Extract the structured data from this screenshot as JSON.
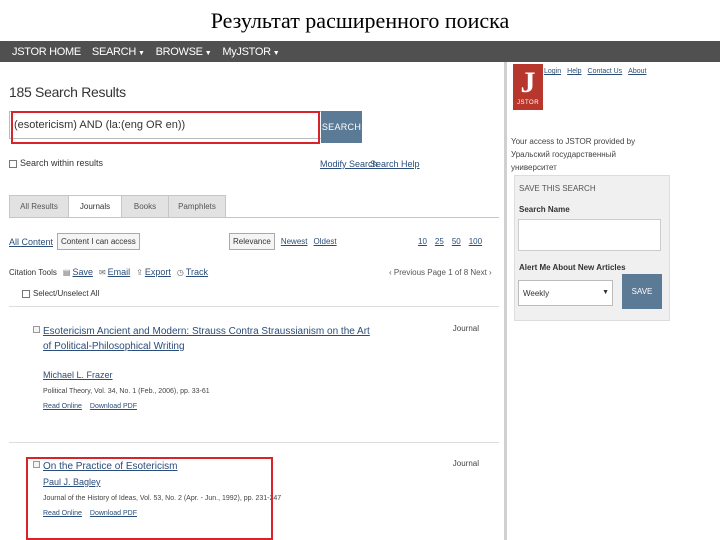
{
  "slide_title": "Результат расширенного поиска",
  "topnav": {
    "items": [
      {
        "label": "JSTOR HOME",
        "caret": false
      },
      {
        "label": "SEARCH",
        "caret": true
      },
      {
        "label": "BROWSE",
        "caret": true
      },
      {
        "label": "MyJSTOR",
        "caret": true
      }
    ]
  },
  "results": {
    "title": "185 Search Results",
    "query": "(esotericism) AND (la:(eng OR en))",
    "search_button": "SEARCH",
    "search_within_label": "Search within results",
    "modify_search": "Modify Search",
    "search_help": "Search Help"
  },
  "tabs": [
    "All Results",
    "Journals",
    "Books",
    "Pamphlets"
  ],
  "active_tab": 1,
  "filters": {
    "all_content": "All Content",
    "content_i_can_access": "Content I can access"
  },
  "sort": {
    "relevance": "Relevance",
    "newest": "Newest",
    "oldest": "Oldest"
  },
  "per_page": [
    "10",
    "25",
    "50",
    "100"
  ],
  "citation_tools": {
    "label": "Citation Tools",
    "save": "Save",
    "email": "Email",
    "export": "Export",
    "track": "Track"
  },
  "pager": "‹ Previous Page 1 of 8 Next ›",
  "select_all": "Select/Unselect All",
  "items": [
    {
      "type": "Journal",
      "title": "Esotericism Ancient and Modern: Strauss Contra Straussianism on the Art of Political-Philosophical Writing",
      "author": "Michael L. Frazer",
      "citation": "Political Theory, Vol. 34, No. 1 (Feb., 2006), pp. 33-61",
      "read_online": "Read Online",
      "download_pdf": "Download PDF"
    },
    {
      "type": "Journal",
      "title": "On the Practice of Esotericism",
      "author": "Paul J. Bagley",
      "citation": "Journal of the History of Ideas, Vol. 53, No. 2 (Apr. - Jun., 1992), pp. 231-247",
      "read_online": "Read Online",
      "download_pdf": "Download PDF"
    }
  ],
  "sidebar": {
    "logo_word": "JSTOR",
    "links": [
      "Login",
      "Help",
      "Contact Us",
      "About"
    ],
    "access_text": "Your access to JSTOR provided by Уральский государственный университет",
    "save_panel": {
      "title": "SAVE THIS SEARCH",
      "search_name_label": "Search Name",
      "alert_label": "Alert Me About New Articles",
      "frequency": "Weekly",
      "save_button": "SAVE"
    }
  },
  "colors": {
    "nav_bg": "#505050",
    "button_blue": "#5a7a96",
    "highlight_red": "#d9232a",
    "logo_red": "#b8372d",
    "link_blue": "#2a4d7a"
  }
}
